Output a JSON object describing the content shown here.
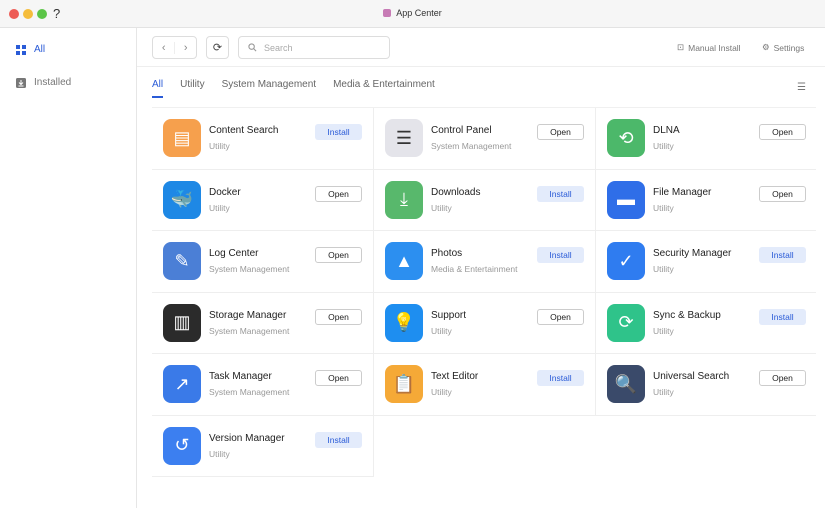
{
  "window": {
    "title": "App Center",
    "help": "?"
  },
  "sidebar": {
    "items": [
      {
        "label": "All",
        "active": true
      },
      {
        "label": "Installed"
      }
    ]
  },
  "toolbar": {
    "search_placeholder": "Search",
    "manual_install": "Manual Install",
    "settings": "Settings"
  },
  "tabs": [
    {
      "label": "All",
      "active": true
    },
    {
      "label": "Utility"
    },
    {
      "label": "System Management"
    },
    {
      "label": "Media & Entertainment"
    }
  ],
  "colors": {
    "accent": "#2a5bd7"
  },
  "apps": [
    {
      "name": "Content Search",
      "category": "Utility",
      "action": "Install",
      "icon": "content-search-icon",
      "color": "#f6a04d",
      "glyph": "▤"
    },
    {
      "name": "Control Panel",
      "category": "System Management",
      "action": "Open",
      "icon": "control-panel-icon",
      "color": "#e4e4ea",
      "glyph": "☰"
    },
    {
      "name": "DLNA",
      "category": "Utility",
      "action": "Open",
      "icon": "dlna-icon",
      "color": "#4cb86a",
      "glyph": "⟲"
    },
    {
      "name": "Docker",
      "category": "Utility",
      "action": "Open",
      "icon": "docker-icon",
      "color": "#1e88e5",
      "glyph": "🐳"
    },
    {
      "name": "Downloads",
      "category": "Utility",
      "action": "Install",
      "icon": "downloads-icon",
      "color": "#58b86c",
      "glyph": "⤓"
    },
    {
      "name": "File Manager",
      "category": "Utility",
      "action": "Open",
      "icon": "file-manager-icon",
      "color": "#2f6ee8",
      "glyph": "▬"
    },
    {
      "name": "Log Center",
      "category": "System Management",
      "action": "Open",
      "icon": "log-center-icon",
      "color": "#4b7fd6",
      "glyph": "✎"
    },
    {
      "name": "Photos",
      "category": "Media & Entertainment",
      "action": "Install",
      "icon": "photos-icon",
      "color": "#2c8ff0",
      "glyph": "▲"
    },
    {
      "name": "Security Manager",
      "category": "Utility",
      "action": "Install",
      "icon": "security-manager-icon",
      "color": "#2f7cf0",
      "glyph": "✓"
    },
    {
      "name": "Storage Manager",
      "category": "System Management",
      "action": "Open",
      "icon": "storage-manager-icon",
      "color": "#2b2b2b",
      "glyph": "▥"
    },
    {
      "name": "Support",
      "category": "Utility",
      "action": "Open",
      "icon": "support-icon",
      "color": "#1e8ef0",
      "glyph": "💡"
    },
    {
      "name": "Sync & Backup",
      "category": "Utility",
      "action": "Install",
      "icon": "sync-backup-icon",
      "color": "#2fc38a",
      "glyph": "⟳"
    },
    {
      "name": "Task Manager",
      "category": "System Management",
      "action": "Open",
      "icon": "task-manager-icon",
      "color": "#3a7ae8",
      "glyph": "↗"
    },
    {
      "name": "Text Editor",
      "category": "Utility",
      "action": "Install",
      "icon": "text-editor-icon",
      "color": "#f5a937",
      "glyph": "📋"
    },
    {
      "name": "Universal Search",
      "category": "Utility",
      "action": "Open",
      "icon": "universal-search-icon",
      "color": "#3a4a6a",
      "glyph": "🔍"
    },
    {
      "name": "Version Manager",
      "category": "Utility",
      "action": "Install",
      "icon": "version-manager-icon",
      "color": "#3c7ff0",
      "glyph": "↺"
    }
  ]
}
